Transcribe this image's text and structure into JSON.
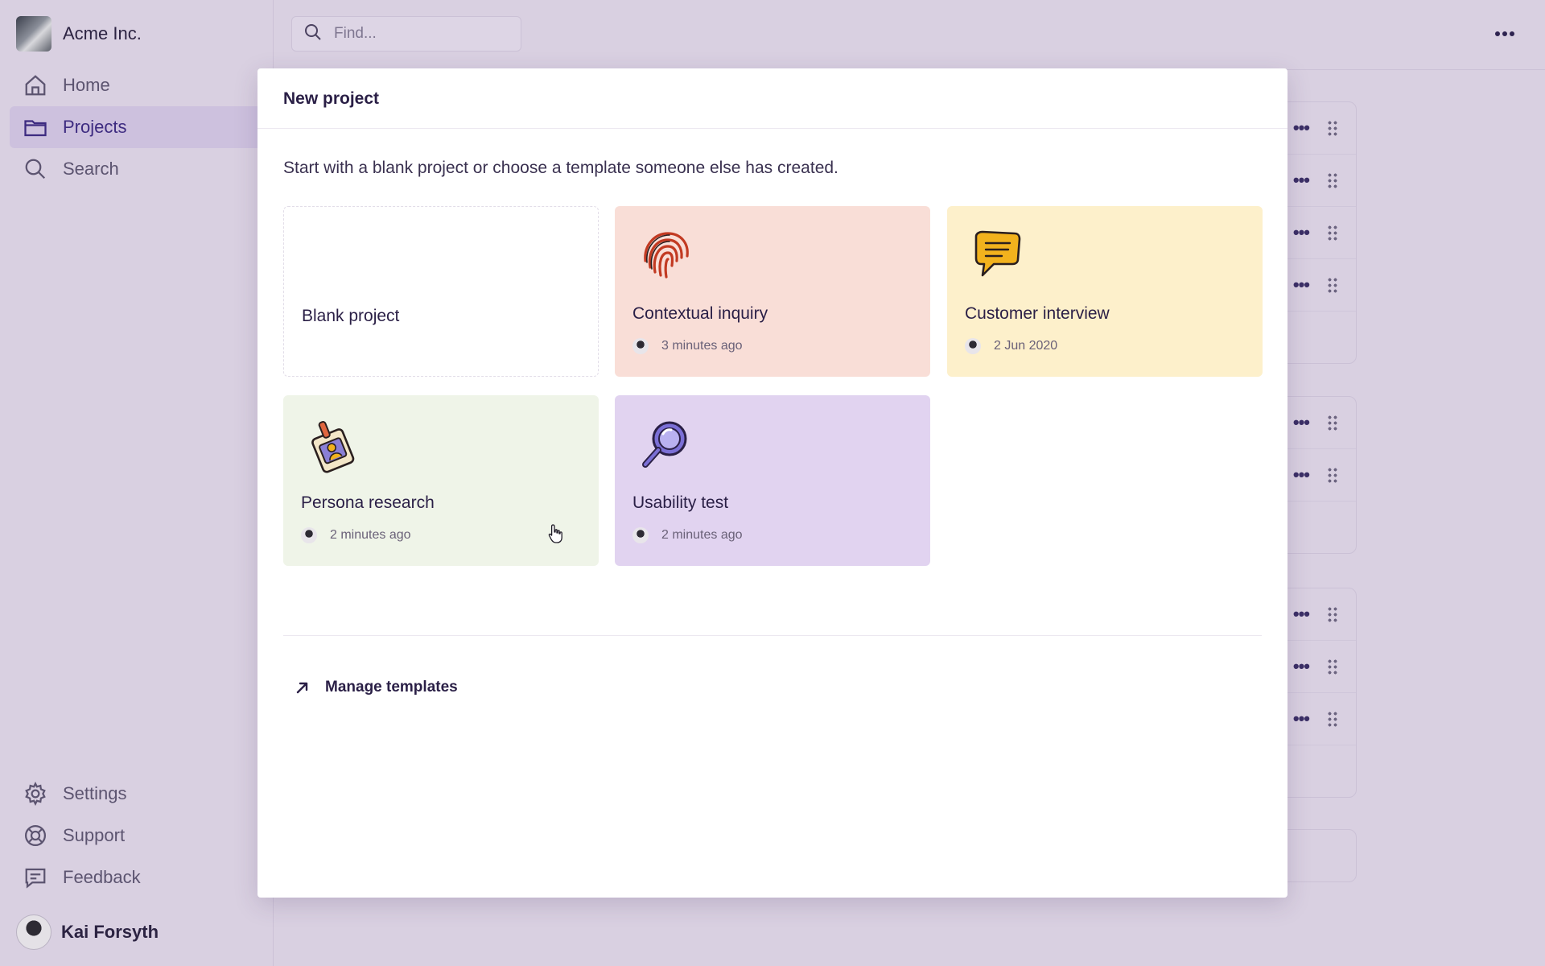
{
  "sidebar": {
    "workspace_name": "Acme Inc.",
    "nav": [
      {
        "label": "Home",
        "icon": "home-icon"
      },
      {
        "label": "Projects",
        "icon": "folder-icon",
        "active": true
      },
      {
        "label": "Search",
        "icon": "search-icon"
      }
    ],
    "bottom_nav": [
      {
        "label": "Settings",
        "icon": "gear-icon"
      },
      {
        "label": "Support",
        "icon": "lifebuoy-icon"
      },
      {
        "label": "Feedback",
        "icon": "message-icon"
      }
    ],
    "user_name": "Kai Forsyth"
  },
  "header": {
    "search_placeholder": "Find..."
  },
  "modal": {
    "title": "New project",
    "description": "Start with a blank project or choose a template someone else has created.",
    "cards": [
      {
        "title": "Blank project",
        "meta": ""
      },
      {
        "title": "Contextual inquiry",
        "meta": "3 minutes ago",
        "icon": "fingerprint-icon",
        "color": "#f9ded7"
      },
      {
        "title": "Customer interview",
        "meta": "2 Jun 2020",
        "icon": "speech-bubble-icon",
        "color": "#fdf0cb"
      },
      {
        "title": "Persona research",
        "meta": "2 minutes ago",
        "icon": "id-badge-icon",
        "color": "#eff4e8"
      },
      {
        "title": "Usability test",
        "meta": "2 minutes ago",
        "icon": "magnifier-icon",
        "color": "#e1d3f0"
      }
    ],
    "manage_label": "Manage templates"
  },
  "colors": {
    "background": "#d9d0e1",
    "accent": "#3d2b80",
    "active_nav": "#cdc1de"
  }
}
